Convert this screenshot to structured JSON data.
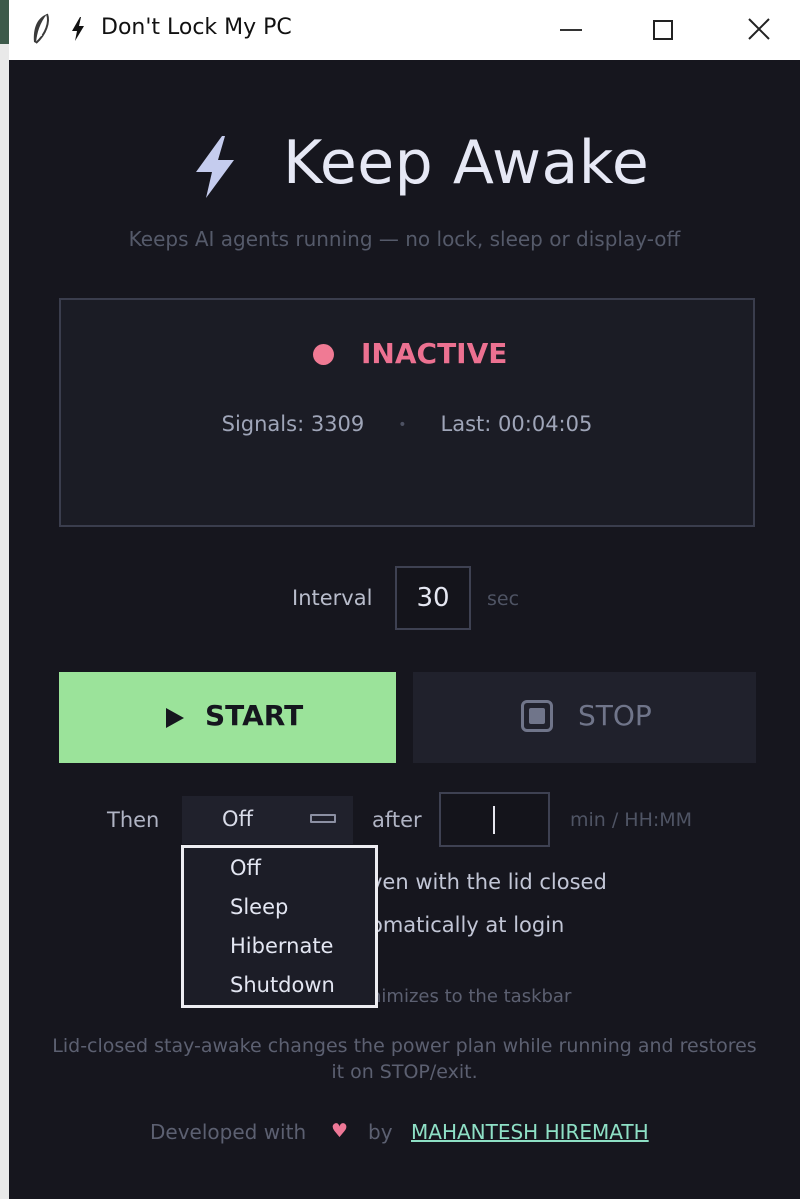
{
  "window": {
    "title": "Don't Lock My PC"
  },
  "header": {
    "title": "Keep Awake",
    "subtitle": "Keeps AI agents running — no lock, sleep or display-off"
  },
  "status": {
    "state": "INACTIVE",
    "state_color": "#ec7191",
    "signals": "Signals: 3309",
    "separator": "•",
    "last": "Last: 00:04:05"
  },
  "interval": {
    "label": "Interval",
    "value": "30",
    "unit": "sec"
  },
  "controls": {
    "start_label": "START",
    "stop_label": "STOP",
    "start_color": "#9be39a"
  },
  "then": {
    "label": "Then",
    "selected": "Off",
    "after_label": "after",
    "after_value": "",
    "after_unit": "min / HH:MM",
    "options": [
      "Off",
      "Sleep",
      "Hibernate",
      "Shutdown"
    ]
  },
  "options": {
    "lid_closed": "ven with the lid closed",
    "login": "omatically at login",
    "tray": "nimizes to the taskbar"
  },
  "note": "Lid-closed stay-awake changes the power plan while running and restores it on STOP/exit.",
  "footer": {
    "developed_with": "Developed with",
    "heart": "♥",
    "by": "by",
    "author": "MAHANTESH HIREMATH"
  }
}
